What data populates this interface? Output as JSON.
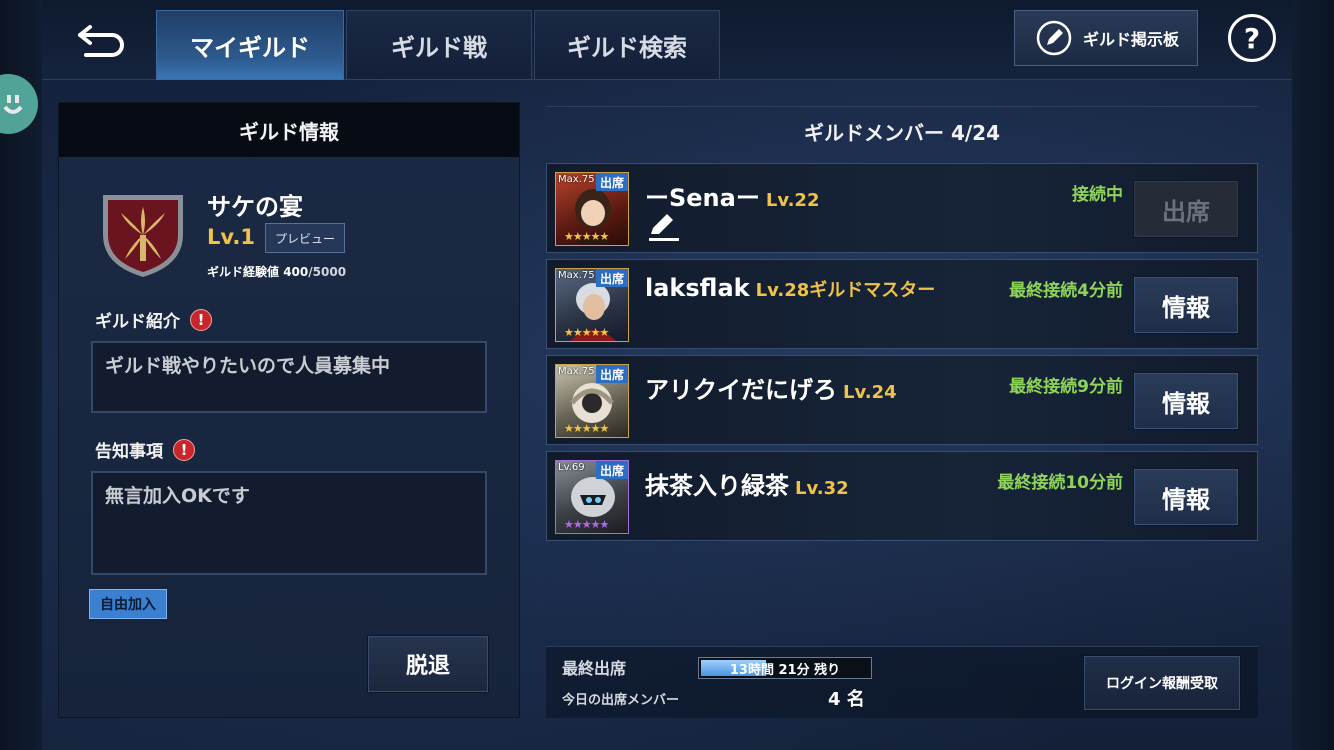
{
  "tabs": [
    {
      "label": "マイギルド",
      "active": true
    },
    {
      "label": "ギルド戦",
      "active": false
    },
    {
      "label": "ギルド検索",
      "active": false
    }
  ],
  "board_button": "ギルド掲示板",
  "help_label": "?",
  "guild_info": {
    "header": "ギルド情報",
    "name": "サケの宴",
    "level": "Lv.1",
    "preview_label": "プレビュー",
    "exp_label": "ギルド経験値",
    "exp_current": "400",
    "exp_total": "/5000",
    "intro_label": "ギルド紹介",
    "intro_text": "ギルド戦やりたいので人員募集中",
    "notice_label": "告知事項",
    "notice_text": "無言加入OKです",
    "join_type": "自由加入",
    "leave_label": "脱退"
  },
  "members": {
    "header": "ギルドメンバー 4/24",
    "list": [
      {
        "name": "ーSenaー",
        "level": "Lv.22",
        "role": "",
        "status": "接続中",
        "button": "出席",
        "button_disabled": true,
        "portrait_lv": "Max.75",
        "attend_tag": "出席",
        "stars": "★★★★★",
        "star_color": "#f3c640",
        "has_memo": true
      },
      {
        "name": "laksflak",
        "level": "Lv.28",
        "role": "ギルドマスター",
        "status": "最終接続4分前",
        "button": "情報",
        "button_disabled": false,
        "portrait_lv": "Max.75",
        "attend_tag": "出席",
        "stars": "★★★★★",
        "star_color": "#f3c640",
        "has_memo": false
      },
      {
        "name": "アリクイだにげろ",
        "level": "Lv.24",
        "role": "",
        "status": "最終接続9分前",
        "button": "情報",
        "button_disabled": false,
        "portrait_lv": "Max.75",
        "attend_tag": "出席",
        "stars": "★★★★★",
        "star_color": "#f3c640",
        "has_memo": false
      },
      {
        "name": "抹茶入り緑茶",
        "level": "Lv.32",
        "role": "",
        "status": "最終接続10分前",
        "button": "情報",
        "button_disabled": false,
        "portrait_lv": "Lv.69",
        "attend_tag": "出席",
        "stars": "★★★★★",
        "star_color": "#b06ae8",
        "has_memo": false
      }
    ]
  },
  "attendance": {
    "last_label": "最終出席",
    "time_left": "13時間 21分 残り",
    "progress_fraction": 0.4,
    "today_label": "今日の出席メンバー",
    "today_count": "4 名",
    "reward_button": "ログイン報酬受取"
  },
  "colors": {
    "accent_gold": "#f0c24a",
    "online_green": "#8fd45a",
    "tab_active": "#2d5a8e"
  }
}
